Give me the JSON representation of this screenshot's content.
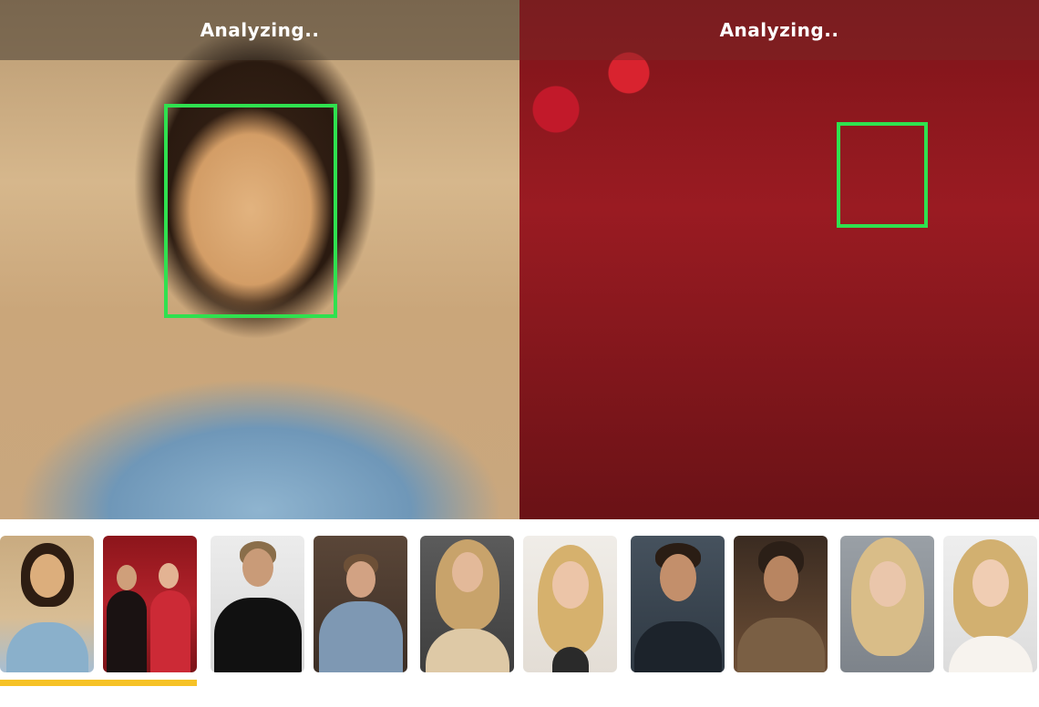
{
  "comparison": {
    "left": {
      "status_label": "Analyzing.."
    },
    "right": {
      "status_label": "Analyzing.."
    },
    "face_box_color": "#2fe14f"
  },
  "thumbnails": {
    "selected_pair_index": 0,
    "selection_color": "#f6c227",
    "pairs": [
      {
        "name": "pair-1",
        "images": [
          "portrait-warm",
          "couple-red-roses"
        ]
      },
      {
        "name": "pair-2",
        "images": [
          "man-suit-black",
          "man-suit-blue"
        ]
      },
      {
        "name": "pair-3",
        "images": [
          "woman-blonde-event",
          "woman-blonde-closeup"
        ]
      },
      {
        "name": "pair-4",
        "images": [
          "man-glasses",
          "man-vintage"
        ]
      },
      {
        "name": "pair-5",
        "images": [
          "woman-blonde-bangs",
          "woman-blonde-red-lips"
        ]
      }
    ]
  }
}
